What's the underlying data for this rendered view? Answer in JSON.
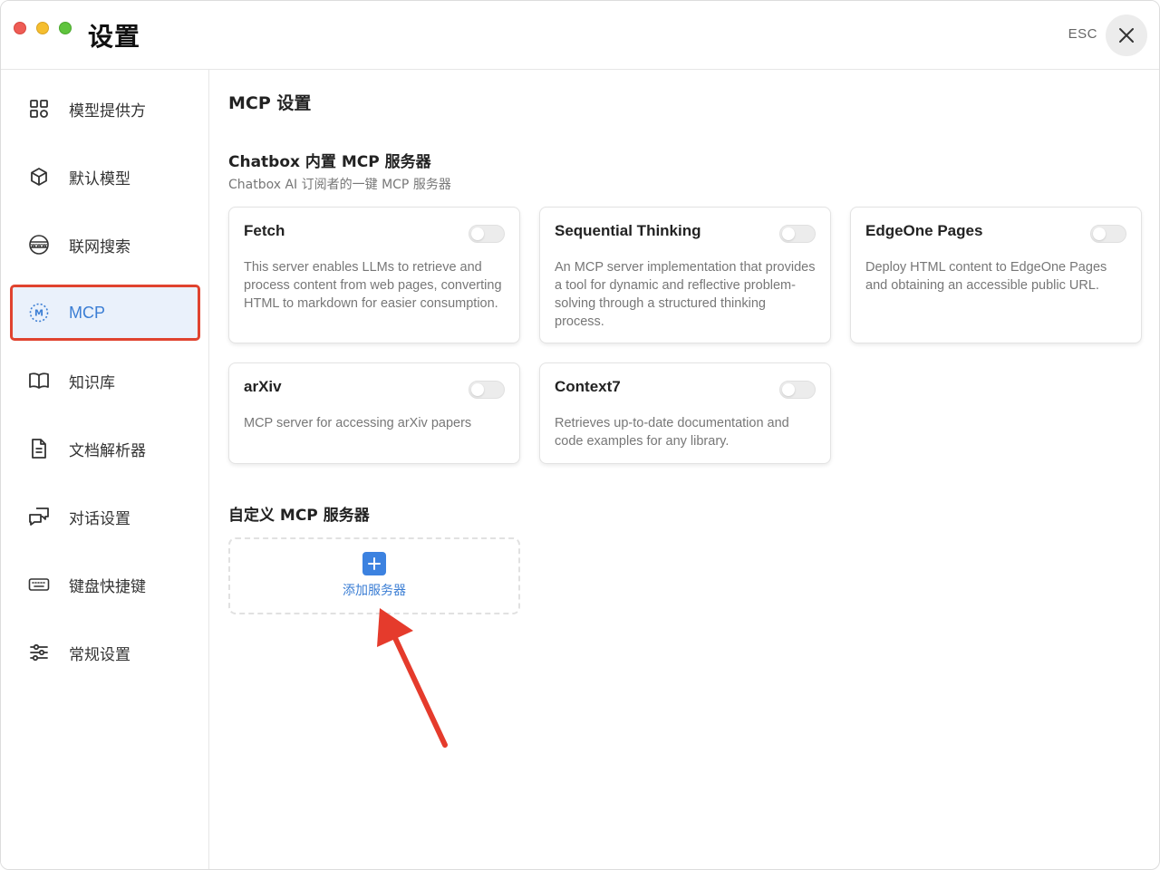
{
  "window": {
    "title": "设置",
    "esc_label": "ESC"
  },
  "sidebar": {
    "items": [
      {
        "label": "模型提供方",
        "icon": "grid-icon"
      },
      {
        "label": "默认模型",
        "icon": "cube-icon"
      },
      {
        "label": "联网搜索",
        "icon": "globe-www-icon"
      },
      {
        "label": "MCP",
        "icon": "mcp-icon",
        "active": true
      },
      {
        "label": "知识库",
        "icon": "book-icon"
      },
      {
        "label": "文档解析器",
        "icon": "document-icon"
      },
      {
        "label": "对话设置",
        "icon": "chat-icon"
      },
      {
        "label": "键盘快捷键",
        "icon": "keyboard-icon"
      },
      {
        "label": "常规设置",
        "icon": "sliders-icon"
      }
    ]
  },
  "main": {
    "title": "MCP 设置",
    "builtin": {
      "title": "Chatbox 内置 MCP 服务器",
      "subtitle": "Chatbox AI 订阅者的一键 MCP 服务器",
      "servers": [
        {
          "name": "Fetch",
          "description": "This server enables LLMs to retrieve and process content from web pages, converting HTML to markdown for easier consumption.",
          "enabled": false
        },
        {
          "name": "Sequential Thinking",
          "description": "An MCP server implementation that provides a tool for dynamic and reflective problem-solving through a structured thinking process.",
          "enabled": false
        },
        {
          "name": "EdgeOne Pages",
          "description": "Deploy HTML content to EdgeOne Pages and obtaining an accessible public URL.",
          "enabled": false
        },
        {
          "name": "arXiv",
          "description": "MCP server for accessing arXiv papers",
          "enabled": false
        },
        {
          "name": "Context7",
          "description": "Retrieves up-to-date documentation and code examples for any library.",
          "enabled": false
        }
      ]
    },
    "custom": {
      "title": "自定义 MCP 服务器",
      "add_label": "添加服务器"
    }
  },
  "colors": {
    "accent": "#3b7ed4",
    "highlight_border": "#e0432f",
    "annotation_arrow": "#e53b2c"
  }
}
